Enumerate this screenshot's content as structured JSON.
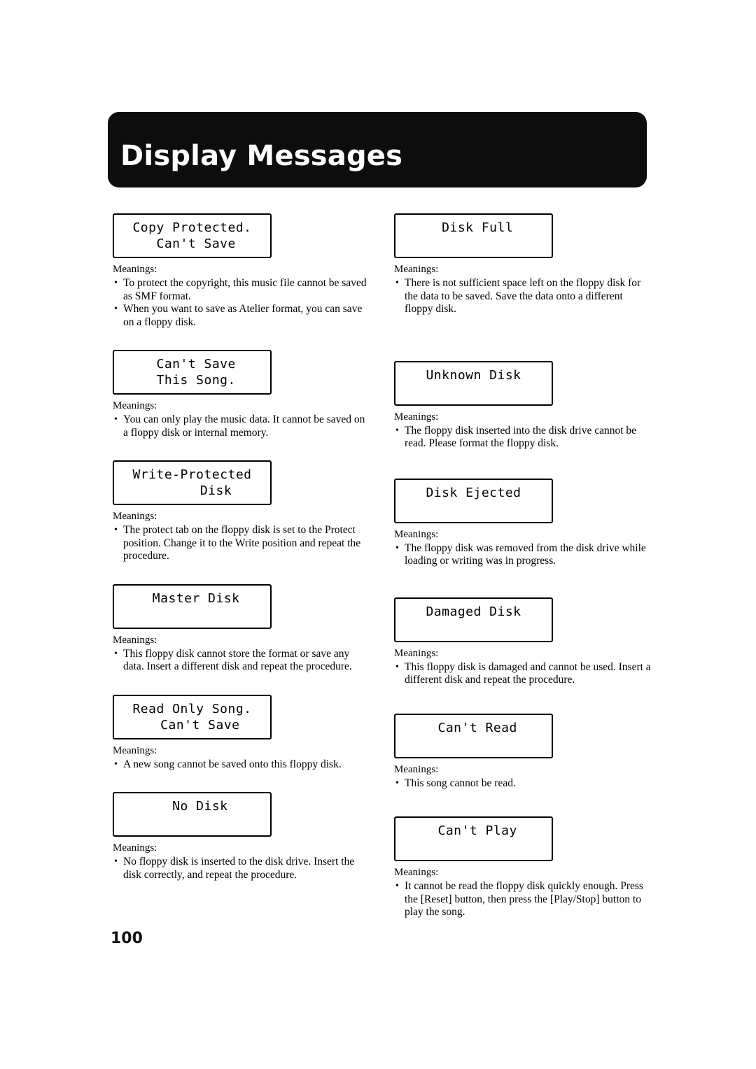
{
  "header": {
    "title": "Display Messages"
  },
  "labels": {
    "meanings": "Meanings:",
    "bullet_glyph": "•"
  },
  "page_number": "100",
  "left_column": [
    {
      "lcd_line1": "Copy Protected.",
      "lcd_line2": " Can't Save",
      "meanings_label": "Meanings:",
      "bullets": [
        "To protect the copyright, this music file cannot be saved as SMF format.",
        "When you want to save as Atelier format, you can save on a floppy disk."
      ]
    },
    {
      "lcd_line1": " Can't Save",
      "lcd_line2": " This Song.",
      "meanings_label": "Meanings:",
      "bullets": [
        "You can only play the music data. It cannot be saved on a floppy disk or internal memory."
      ]
    },
    {
      "lcd_line1": "Write-Protected",
      "lcd_line2": "      Disk",
      "meanings_label": "Meanings:",
      "bullets": [
        "The protect tab on the floppy disk is set to the Protect position. Change it to the Write position and repeat the procedure."
      ]
    },
    {
      "lcd_line1": " Master Disk",
      "lcd_line2": "",
      "meanings_label": "Meanings:",
      "bullets": [
        "This floppy disk cannot store the format or save any data. Insert a different disk and repeat the procedure."
      ]
    },
    {
      "lcd_line1": "Read Only Song.",
      "lcd_line2": "  Can't Save",
      "meanings_label": "Meanings:",
      "bullets": [
        "A new song cannot be saved onto this floppy disk."
      ]
    },
    {
      "lcd_line1": "  No Disk",
      "lcd_line2": "",
      "meanings_label": "Meanings:",
      "bullets": [
        "No floppy disk is inserted to the disk drive. Insert the disk correctly, and repeat the procedure."
      ]
    }
  ],
  "right_column": [
    {
      "lcd_line1": " Disk Full",
      "lcd_line2": "",
      "meanings_label": "Meanings:",
      "bullets": [
        "There is not sufficient space left on the floppy disk for the data to be saved. Save the data onto a different floppy disk."
      ]
    },
    {
      "lcd_line1": "Unknown Disk",
      "lcd_line2": "",
      "meanings_label": "Meanings:",
      "bullets": [
        "The floppy disk inserted into the disk drive cannot be read. Please format the floppy disk."
      ]
    },
    {
      "lcd_line1": "Disk Ejected",
      "lcd_line2": "",
      "meanings_label": "Meanings:",
      "bullets": [
        "The floppy disk was removed from the disk drive while loading or writing was in progress."
      ]
    },
    {
      "lcd_line1": "Damaged Disk",
      "lcd_line2": "",
      "meanings_label": "Meanings:",
      "bullets": [
        "This floppy disk is damaged and cannot be used. Insert a different disk and repeat the procedure."
      ]
    },
    {
      "lcd_line1": " Can't Read",
      "lcd_line2": "",
      "meanings_label": "Meanings:",
      "bullets": [
        "This song cannot be read."
      ]
    },
    {
      "lcd_line1": " Can't Play",
      "lcd_line2": "",
      "meanings_label": "Meanings:",
      "bullets": [
        "It cannot be read the floppy disk quickly enough. Press the [Reset] button, then press the [Play/Stop] button to play the song."
      ]
    }
  ],
  "spacing": {
    "left_gaps": [
      30,
      30,
      30,
      30,
      30,
      0
    ],
    "right_gaps": [
      64,
      40,
      42,
      38,
      38,
      0
    ]
  }
}
